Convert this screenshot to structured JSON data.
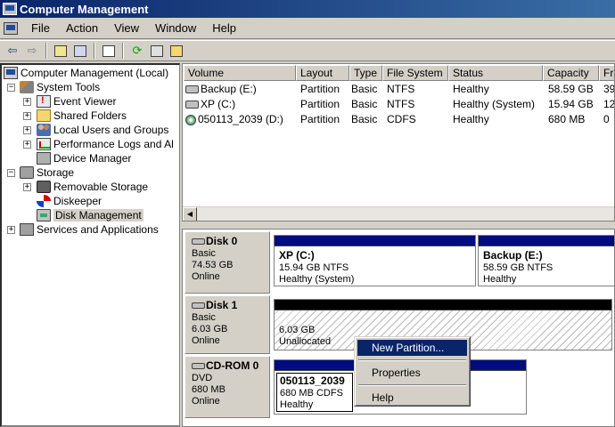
{
  "window": {
    "title": "Computer Management"
  },
  "menu": [
    "File",
    "Action",
    "View",
    "Window",
    "Help"
  ],
  "toolbar": [
    "back-arrow-icon",
    "forward-arrow-icon",
    "up-folder-icon",
    "show-tree-icon",
    "properties-icon",
    "refresh-icon",
    "export-icon",
    "help-icon"
  ],
  "tree": {
    "root": "Computer Management (Local)",
    "system_tools": "System Tools",
    "event_viewer": "Event Viewer",
    "shared_folders": "Shared Folders",
    "local_users": "Local Users and Groups",
    "perf_logs": "Performance Logs and Al",
    "device_manager": "Device Manager",
    "storage": "Storage",
    "removable_storage": "Removable Storage",
    "diskeeper": "Diskeeper",
    "disk_management": "Disk Management",
    "services": "Services and Applications"
  },
  "volumes": {
    "columns": [
      "Volume",
      "Layout",
      "Type",
      "File System",
      "Status",
      "Capacity",
      "Fre"
    ],
    "rows": [
      [
        "Backup (E:)",
        "Partition",
        "Basic",
        "NTFS",
        "Healthy",
        "58.59 GB",
        "39"
      ],
      [
        "XP (C:)",
        "Partition",
        "Basic",
        "NTFS",
        "Healthy (System)",
        "15.94 GB",
        "12"
      ],
      [
        "050113_2039 (D:)",
        "Partition",
        "Basic",
        "CDFS",
        "Healthy",
        "680 MB",
        "0"
      ]
    ]
  },
  "disks": {
    "disk0": {
      "name": "Disk 0",
      "type": "Basic",
      "size": "74.53 GB",
      "state": "Online"
    },
    "disk1": {
      "name": "Disk 1",
      "type": "Basic",
      "size": "6.03 GB",
      "state": "Online"
    },
    "cdrom0": {
      "name": "CD-ROM 0",
      "type": "DVD",
      "size": "680 MB",
      "state": "Online"
    }
  },
  "partitions": {
    "xp": {
      "label": "XP  (C:)",
      "detail": "15.94 GB NTFS",
      "status": "Healthy (System)"
    },
    "backup": {
      "label": "Backup  (E:)",
      "detail": "58.59 GB NTFS",
      "status": "Healthy"
    },
    "unalloc": {
      "size": "6.03 GB",
      "status": "Unallocated"
    },
    "cd": {
      "label": "050113_2039",
      "detail": "680 MB CDFS",
      "status": "Healthy"
    }
  },
  "context_menu": {
    "new_partition": "New Partition...",
    "properties": "Properties",
    "help": "Help"
  },
  "colors": {
    "title_start": "#0a246a",
    "title_end": "#3a6ea5",
    "partition_bar": "#000c80",
    "highlight": "#0a246a"
  }
}
